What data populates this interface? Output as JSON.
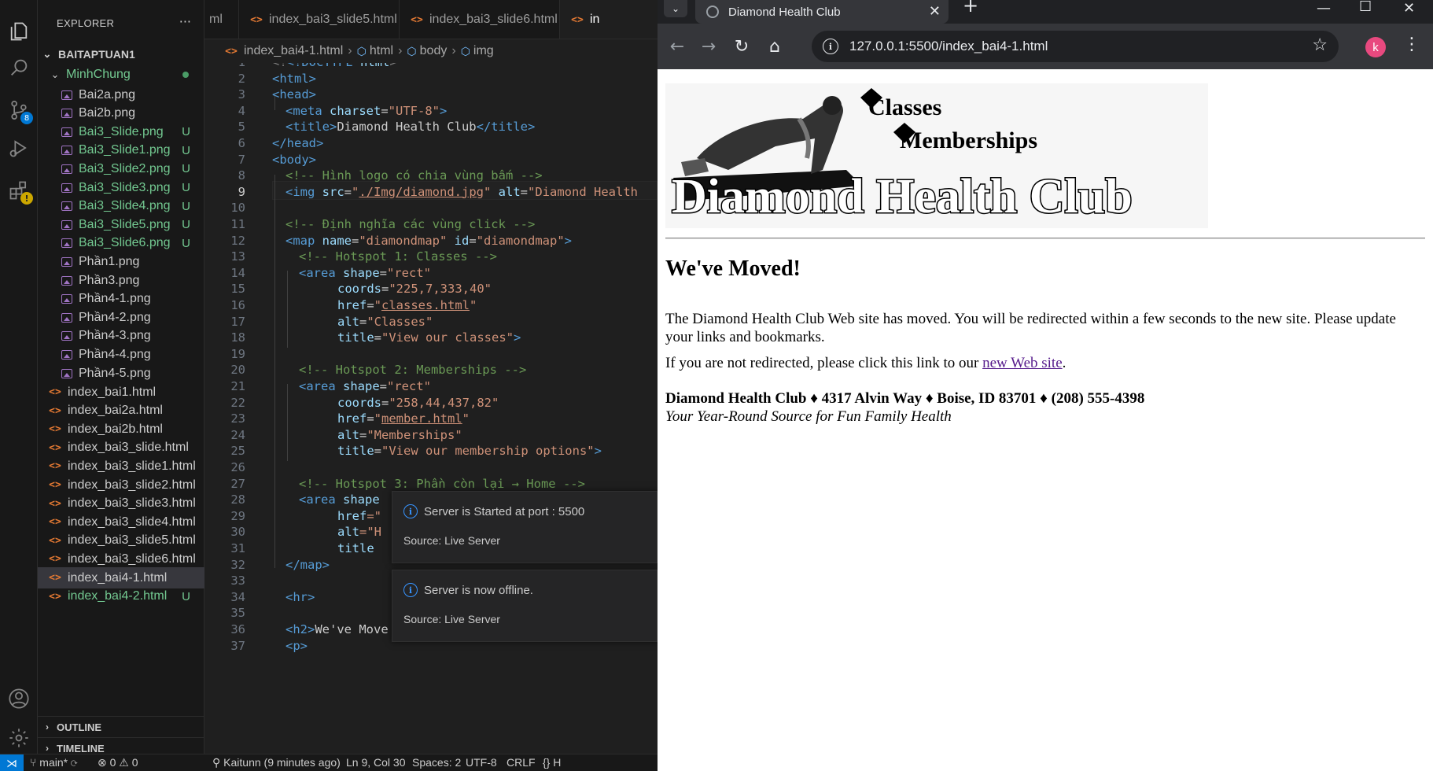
{
  "vscode": {
    "explorer_title": "EXPLORER",
    "explorer_more": "···",
    "source_control_badge": "8",
    "folder": "BAITAPTUAN1",
    "subfolder": "MinhChung",
    "files": [
      {
        "name": "Bai2a.png",
        "type": "image",
        "status": ""
      },
      {
        "name": "Bai2b.png",
        "type": "image",
        "status": ""
      },
      {
        "name": "Bai3_Slide.png",
        "type": "image",
        "status": "U"
      },
      {
        "name": "Bai3_Slide1.png",
        "type": "image",
        "status": "U"
      },
      {
        "name": "Bai3_Slide2.png",
        "type": "image",
        "status": "U"
      },
      {
        "name": "Bai3_Slide3.png",
        "type": "image",
        "status": "U"
      },
      {
        "name": "Bai3_Slide4.png",
        "type": "image",
        "status": "U"
      },
      {
        "name": "Bai3_Slide5.png",
        "type": "image",
        "status": "U"
      },
      {
        "name": "Bai3_Slide6.png",
        "type": "image",
        "status": "U"
      },
      {
        "name": "Phần1.png",
        "type": "image",
        "status": ""
      },
      {
        "name": "Phần3.png",
        "type": "image",
        "status": ""
      },
      {
        "name": "Phần4-1.png",
        "type": "image",
        "status": ""
      },
      {
        "name": "Phần4-2.png",
        "type": "image",
        "status": ""
      },
      {
        "name": "Phần4-3.png",
        "type": "image",
        "status": ""
      },
      {
        "name": "Phần4-4.png",
        "type": "image",
        "status": ""
      },
      {
        "name": "Phần4-5.png",
        "type": "image",
        "status": ""
      }
    ],
    "root_files": [
      {
        "name": "index_bai1.html",
        "status": ""
      },
      {
        "name": "index_bai2a.html",
        "status": ""
      },
      {
        "name": "index_bai2b.html",
        "status": ""
      },
      {
        "name": "index_bai3_slide.html",
        "status": ""
      },
      {
        "name": "index_bai3_slide1.html",
        "status": ""
      },
      {
        "name": "index_bai3_slide2.html",
        "status": ""
      },
      {
        "name": "index_bai3_slide3.html",
        "status": ""
      },
      {
        "name": "index_bai3_slide4.html",
        "status": ""
      },
      {
        "name": "index_bai3_slide5.html",
        "status": ""
      },
      {
        "name": "index_bai3_slide6.html",
        "status": ""
      },
      {
        "name": "index_bai4-1.html",
        "status": "selected"
      },
      {
        "name": "index_bai4-2.html",
        "status": "U"
      }
    ],
    "outline": "OUTLINE",
    "timeline": "TIMELINE",
    "tabs": [
      "ml",
      "index_bai3_slide5.html",
      "index_bai3_slide6.html",
      "in"
    ],
    "breadcrumb": [
      "index_bai4-1.html",
      "html",
      "body",
      "img"
    ],
    "line_numbers": [
      "1",
      "2",
      "3",
      "4",
      "5",
      "6",
      "7",
      "8",
      "9",
      "10",
      "11",
      "12",
      "13",
      "14",
      "15",
      "16",
      "17",
      "18",
      "19",
      "20",
      "21",
      "22",
      "23",
      "24",
      "25",
      "26",
      "27",
      "28",
      "29",
      "30",
      "31",
      "32",
      "33",
      "34",
      "35",
      "36",
      "37"
    ],
    "code": {
      "l1a": "<!DOCTYPE",
      "l1b": " html",
      "l1c": ">",
      "l2": "<html>",
      "l3": "<head>",
      "l4a": "<meta",
      "l4b": " charset",
      "l4c": "=",
      "l4d": "\"UTF-8\"",
      "l4e": ">",
      "l5a": "<title>",
      "l5b": "Diamond Health Club",
      "l5c": "</title>",
      "l6": "</head>",
      "l7": "<body>",
      "l8": "<!-- Hình logo có chia vùng bấm -->",
      "l9a": "<img",
      "l9b": " src",
      "l9c": "=",
      "l9d": "\"",
      "l9e": "./Img/diamond.jpg",
      "l9f": "\"",
      "l9g": " alt",
      "l9h": "=",
      "l9i": "\"Diamond Health",
      "l11": "<!-- Định nghĩa các vùng click -->",
      "l12a": "<map",
      "l12b": " name",
      "l12c": "=",
      "l12d": "\"diamondmap\"",
      "l12e": " id",
      "l12f": "=",
      "l12g": "\"diamondmap\"",
      "l12h": ">",
      "l13": "<!-- Hotspot 1: Classes -->",
      "l14a": "<area",
      "l14b": " shape",
      "l14c": "=",
      "l14d": "\"rect\"",
      "l15a": "coords",
      "l15b": "=",
      "l15c": "\"225,7,333,40\"",
      "l16a": "href",
      "l16b": "=",
      "l16c": "\"",
      "l16d": "classes.html",
      "l16e": "\"",
      "l17a": "alt",
      "l17b": "=",
      "l17c": "\"Classes\"",
      "l18a": "title",
      "l18b": "=",
      "l18c": "\"View our classes\"",
      "l18d": ">",
      "l20": "<!-- Hotspot 2: Memberships -->",
      "l21a": "<area",
      "l21b": " shape",
      "l21c": "=",
      "l21d": "\"rect\"",
      "l22a": "coords",
      "l22b": "=",
      "l22c": "\"258,44,437,82\"",
      "l23a": "href",
      "l23b": "=",
      "l23c": "\"",
      "l23d": "member.html",
      "l23e": "\"",
      "l24a": "alt",
      "l24b": "=",
      "l24c": "\"Memberships\"",
      "l25a": "title",
      "l25b": "=",
      "l25c": "\"View our membership options\"",
      "l25d": ">",
      "l27": "<!-- Hotspot 3: Phần còn lại → Home -->",
      "l28a": "<area",
      "l28b": " shape",
      "l29a": "href",
      "l29b": "=\"",
      "l30a": "alt",
      "l30b": "=\"H",
      "l31a": "title",
      "l32": "</map>",
      "l34": "<hr>",
      "l36a": "<h2>",
      "l36b": "We've Move",
      "l37": "<p>"
    },
    "notifications": [
      {
        "message": "Server is Started at port : 5500",
        "source": "Source: Live Server"
      },
      {
        "message": "Server is now offline.",
        "source": "Source: Live Server"
      }
    ],
    "status": {
      "branch": "main*",
      "problems": "⊗ 0 ⚠ 0",
      "blame": "Kaitunn (9 minutes ago)",
      "position": "Ln 9, Col 30",
      "spaces": "Spaces: 2",
      "encoding": "UTF-8",
      "eol": "CRLF",
      "lang": "{} H"
    }
  },
  "browser": {
    "tab_title": "Diamond Health Club",
    "url": "127.0.0.1:5500/index_bai4-1.html",
    "profile_initial": "k",
    "page": {
      "logo_top": "Classes",
      "logo_mid": "Memberships",
      "logo_main": "Diamond Health Club",
      "heading": "We've Moved!",
      "para1": "The Diamond Health Club Web site has moved. You will be redirected within a few seconds to the new site. Please update your links and bookmarks.",
      "para2_prefix": "If you are not redirected, please click this link to our ",
      "para2_link": "new Web site",
      "para2_suffix": ".",
      "address": "Diamond Health Club ♦ 4317 Alvin Way ♦ Boise, ID 83701 ♦ (208) 555-4398",
      "tagline": "Your Year-Round Source for Fun Family Health"
    }
  },
  "colors": {
    "accent": "#0078d4",
    "untracked": "#73c991",
    "link_visited": "#551a8b"
  }
}
